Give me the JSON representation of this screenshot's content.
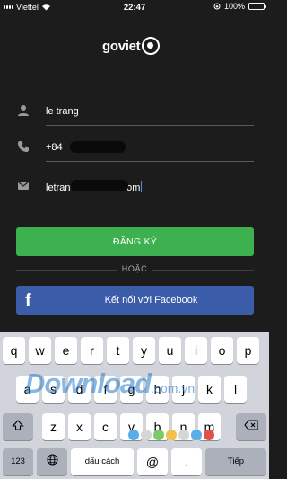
{
  "status_bar": {
    "carrier": "Viettel",
    "time": "22:47",
    "battery": "100%"
  },
  "logo": {
    "text": "goviet"
  },
  "form": {
    "name": "le trang",
    "phone_prefix": "+84",
    "email_start": "letran",
    "email_end": ".com"
  },
  "buttons": {
    "register": "ĐĂNG KÝ",
    "or": "HOẶC",
    "facebook": "Kết nối với Facebook",
    "facebook_icon": "f"
  },
  "keyboard": {
    "row1": [
      "q",
      "w",
      "e",
      "r",
      "t",
      "y",
      "u",
      "i",
      "o",
      "p"
    ],
    "row2": [
      "a",
      "s",
      "d",
      "f",
      "g",
      "h",
      "j",
      "k",
      "l"
    ],
    "row3": [
      "z",
      "x",
      "c",
      "v",
      "b",
      "n",
      "m"
    ],
    "numbers": "123",
    "space": "dấu cách",
    "at": "@",
    "dot": ".",
    "return": "Tiếp"
  },
  "watermark": {
    "text": "Download",
    "domain": ".com.vn"
  },
  "colors": {
    "register": "#3db14f",
    "facebook": "#3b5ca8",
    "background": "#1c1c1c"
  }
}
